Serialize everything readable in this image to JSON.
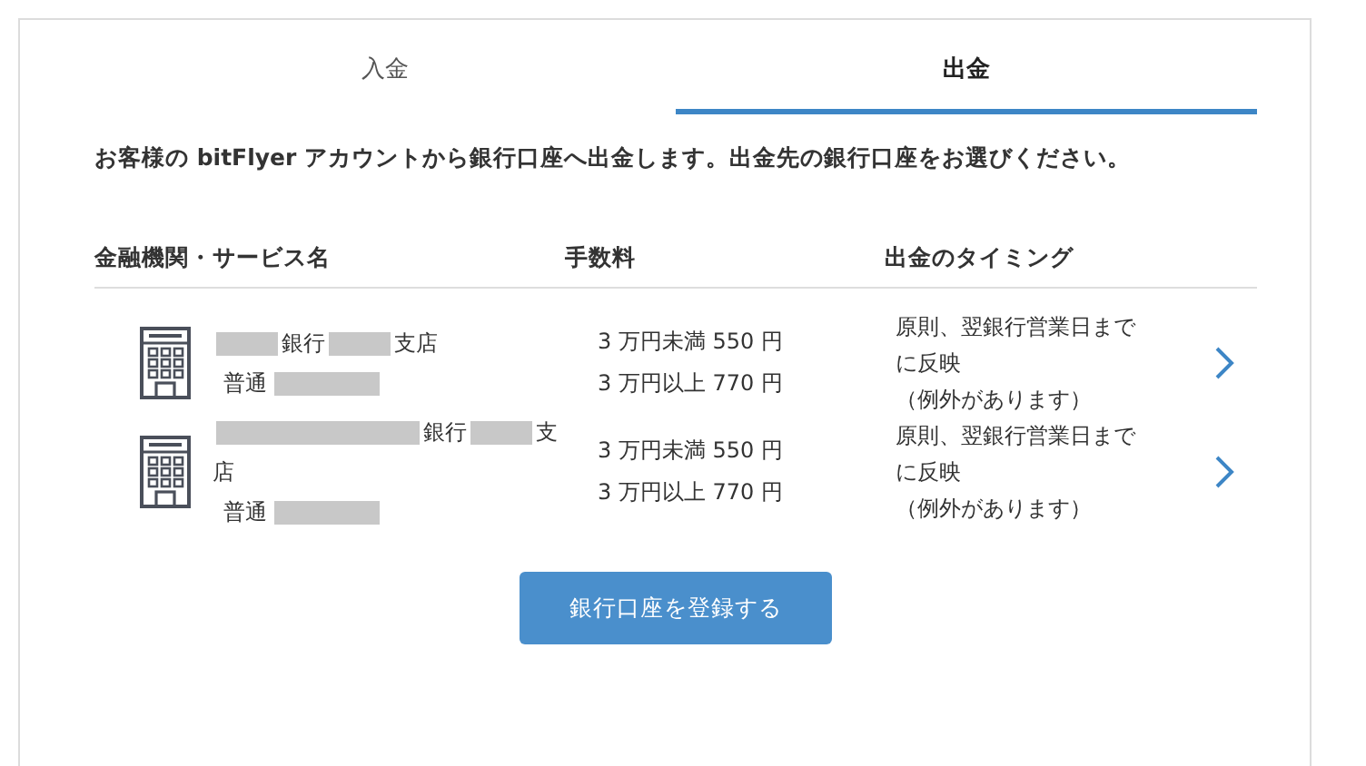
{
  "tabs": [
    {
      "label": "入金",
      "selected": false
    },
    {
      "label": "出金",
      "selected": true
    }
  ],
  "description": "お客様の bitFlyer アカウントから銀行口座へ出金します。出金先の銀行口座をお選びください。",
  "columns": [
    "金融機関・サービス名",
    "手数料",
    "出金のタイミング"
  ],
  "accounts": [
    {
      "bank_name": [
        {
          "kind": "redacted_short"
        },
        {
          "kind": "text",
          "text": "銀行"
        },
        {
          "kind": "redacted_short"
        },
        {
          "kind": "text",
          "text": "支店"
        }
      ],
      "account_type": "普通",
      "fees": [
        "3 万円未満 550 円",
        "3 万円以上 770 円"
      ],
      "timing": [
        "原則、翌銀行営業日までに反映",
        "（例外があります）"
      ]
    },
    {
      "bank_name": [
        {
          "kind": "redacted_long"
        },
        {
          "kind": "text",
          "text": "銀行"
        },
        {
          "kind": "redacted_short"
        },
        {
          "kind": "text",
          "text": "支"
        },
        {
          "kind": "text",
          "text": "店"
        }
      ],
      "account_type": "普通",
      "fees": [
        "3 万円未満 550 円",
        "3 万円以上 770 円"
      ],
      "timing": [
        "原則、翌銀行営業日までに反映",
        "（例外があります）"
      ]
    }
  ],
  "register_button": "銀行口座を登録する"
}
